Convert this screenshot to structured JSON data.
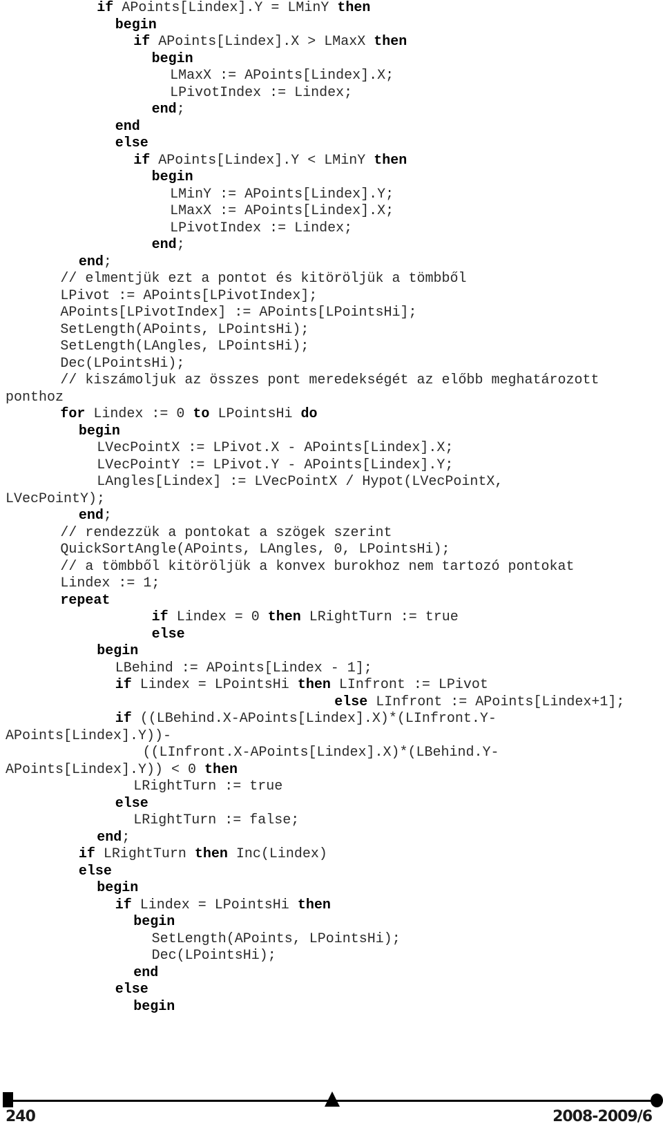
{
  "code_lines": [
    {
      "indent": 5,
      "segments": [
        [
          "k",
          "if"
        ],
        [
          "t",
          " APoints[Lindex].Y = LMinY "
        ],
        [
          "k",
          "then"
        ]
      ]
    },
    {
      "indent": 6,
      "segments": [
        [
          "k",
          "begin"
        ]
      ]
    },
    {
      "indent": 7,
      "segments": [
        [
          "k",
          "if"
        ],
        [
          "t",
          " APoints[Lindex].X > LMaxX "
        ],
        [
          "k",
          "then"
        ]
      ]
    },
    {
      "indent": 8,
      "segments": [
        [
          "k",
          "begin"
        ]
      ]
    },
    {
      "indent": 9,
      "segments": [
        [
          "t",
          "LMaxX := APoints[Lindex].X;"
        ]
      ]
    },
    {
      "indent": 9,
      "segments": [
        [
          "t",
          "LPivotIndex := Lindex;"
        ]
      ]
    },
    {
      "indent": 8,
      "segments": [
        [
          "k",
          "end"
        ],
        [
          "t",
          ";"
        ]
      ]
    },
    {
      "indent": 6,
      "segments": [
        [
          "k",
          "end"
        ]
      ]
    },
    {
      "indent": 6,
      "segments": [
        [
          "k",
          "else"
        ]
      ]
    },
    {
      "indent": 7,
      "segments": [
        [
          "k",
          "if"
        ],
        [
          "t",
          " APoints[Lindex].Y < LMinY "
        ],
        [
          "k",
          "then"
        ]
      ]
    },
    {
      "indent": 8,
      "segments": [
        [
          "k",
          "begin"
        ]
      ]
    },
    {
      "indent": 9,
      "segments": [
        [
          "t",
          "LMinY := APoints[Lindex].Y;"
        ]
      ]
    },
    {
      "indent": 9,
      "segments": [
        [
          "t",
          "LMaxX := APoints[Lindex].X;"
        ]
      ]
    },
    {
      "indent": 9,
      "segments": [
        [
          "t",
          "LPivotIndex := Lindex;"
        ]
      ]
    },
    {
      "indent": 8,
      "segments": [
        [
          "k",
          "end"
        ],
        [
          "t",
          ";"
        ]
      ]
    },
    {
      "indent": 4,
      "segments": [
        [
          "k",
          "end"
        ],
        [
          "t",
          ";"
        ]
      ]
    },
    {
      "indent": 3,
      "segments": [
        [
          "t",
          "// elmentjük ezt a pontot és kitöröljük a tömbből"
        ]
      ]
    },
    {
      "indent": 3,
      "segments": [
        [
          "t",
          "LPivot := APoints[LPivotIndex];"
        ]
      ]
    },
    {
      "indent": 3,
      "segments": [
        [
          "t",
          "APoints[LPivotIndex] := APoints[LPointsHi];"
        ]
      ]
    },
    {
      "indent": 3,
      "segments": [
        [
          "t",
          "SetLength(APoints, LPointsHi);"
        ]
      ]
    },
    {
      "indent": 3,
      "segments": [
        [
          "t",
          "SetLength(LAngles, LPointsHi);"
        ]
      ]
    },
    {
      "indent": 3,
      "segments": [
        [
          "t",
          "Dec(LPointsHi);"
        ]
      ]
    },
    {
      "indent": 3,
      "segments": [
        [
          "t",
          "// kiszámoljuk az összes pont meredekségét az előbb meghatározott"
        ]
      ]
    },
    {
      "indent": 0,
      "segments": [
        [
          "t",
          "ponthoz"
        ]
      ]
    },
    {
      "indent": 3,
      "segments": [
        [
          "k",
          "for"
        ],
        [
          "t",
          " Lindex := 0 "
        ],
        [
          "k",
          "to"
        ],
        [
          "t",
          " LPointsHi "
        ],
        [
          "k",
          "do"
        ]
      ]
    },
    {
      "indent": 4,
      "segments": [
        [
          "k",
          "begin"
        ]
      ]
    },
    {
      "indent": 5,
      "segments": [
        [
          "t",
          "LVecPointX := LPivot.X - APoints[Lindex].X;"
        ]
      ]
    },
    {
      "indent": 5,
      "segments": [
        [
          "t",
          "LVecPointY := LPivot.Y - APoints[Lindex].Y;"
        ]
      ]
    },
    {
      "indent": 5,
      "segments": [
        [
          "t",
          "LAngles[Lindex] := LVecPointX / Hypot(LVecPointX,"
        ]
      ]
    },
    {
      "indent": 0,
      "segments": [
        [
          "t",
          "LVecPointY);"
        ]
      ]
    },
    {
      "indent": 4,
      "segments": [
        [
          "k",
          "end"
        ],
        [
          "t",
          ";"
        ]
      ]
    },
    {
      "indent": 3,
      "segments": [
        [
          "t",
          "// rendezzük a pontokat a szögek szerint"
        ]
      ]
    },
    {
      "indent": 3,
      "segments": [
        [
          "t",
          "QuickSortAngle(APoints, LAngles, 0, LPointsHi);"
        ]
      ]
    },
    {
      "indent": 3,
      "segments": [
        [
          "t",
          "// a tömbből kitöröljük a konvex burokhoz nem tartozó pontokat"
        ]
      ]
    },
    {
      "indent": 3,
      "segments": [
        [
          "t",
          "Lindex := 1;"
        ]
      ]
    },
    {
      "indent": 3,
      "segments": [
        [
          "k",
          "repeat"
        ]
      ]
    },
    {
      "indent": 8,
      "segments": [
        [
          "k",
          "if"
        ],
        [
          "t",
          " Lindex = 0 "
        ],
        [
          "k",
          "then"
        ],
        [
          "t",
          " LRightTurn := true"
        ]
      ]
    },
    {
      "indent": 8,
      "segments": [
        [
          "k",
          "else"
        ]
      ]
    },
    {
      "indent": 5,
      "segments": [
        [
          "k",
          "begin"
        ]
      ]
    },
    {
      "indent": 6,
      "segments": [
        [
          "t",
          "LBehind := APoints[Lindex - 1];"
        ]
      ]
    },
    {
      "indent": 6,
      "segments": [
        [
          "k",
          "if"
        ],
        [
          "t",
          " Lindex = LPointsHi "
        ],
        [
          "k",
          "then"
        ],
        [
          "t",
          " LInfront := LPivot"
        ]
      ]
    },
    {
      "indent": 18,
      "segments": [
        [
          "k",
          "else"
        ],
        [
          "t",
          " LInfront := APoints[Lindex+1];"
        ]
      ]
    },
    {
      "indent": 6,
      "segments": [
        [
          "k",
          "if"
        ],
        [
          "t",
          " ((LBehind.X-APoints[Lindex].X)*(LInfront.Y-"
        ]
      ]
    },
    {
      "indent": 0,
      "segments": [
        [
          "t",
          "APoints[Lindex].Y))-"
        ]
      ]
    },
    {
      "indent": 7.5,
      "segments": [
        [
          "t",
          "((LInfront.X-APoints[Lindex].X)*(LBehind.Y-"
        ]
      ]
    },
    {
      "indent": 0,
      "segments": [
        [
          "t",
          "APoints[Lindex].Y)) < 0 "
        ],
        [
          "k",
          "then"
        ]
      ]
    },
    {
      "indent": 7,
      "segments": [
        [
          "t",
          "LRightTurn := true"
        ]
      ]
    },
    {
      "indent": 6,
      "segments": [
        [
          "k",
          "else"
        ]
      ]
    },
    {
      "indent": 7,
      "segments": [
        [
          "t",
          "LRightTurn := false;"
        ]
      ]
    },
    {
      "indent": 5,
      "segments": [
        [
          "k",
          "end"
        ],
        [
          "t",
          ";"
        ]
      ]
    },
    {
      "indent": 4,
      "segments": [
        [
          "k",
          "if"
        ],
        [
          "t",
          " LRightTurn "
        ],
        [
          "k",
          "then"
        ],
        [
          "t",
          " Inc(Lindex)"
        ]
      ]
    },
    {
      "indent": 4,
      "segments": [
        [
          "k",
          "else"
        ]
      ]
    },
    {
      "indent": 5,
      "segments": [
        [
          "k",
          "begin"
        ]
      ]
    },
    {
      "indent": 6,
      "segments": [
        [
          "k",
          "if"
        ],
        [
          "t",
          " Lindex = LPointsHi "
        ],
        [
          "k",
          "then"
        ]
      ]
    },
    {
      "indent": 7,
      "segments": [
        [
          "k",
          "begin"
        ]
      ]
    },
    {
      "indent": 8,
      "segments": [
        [
          "t",
          "SetLength(APoints, LPointsHi);"
        ]
      ]
    },
    {
      "indent": 8,
      "segments": [
        [
          "t",
          "Dec(LPointsHi);"
        ]
      ]
    },
    {
      "indent": 7,
      "segments": [
        [
          "k",
          "end"
        ]
      ]
    },
    {
      "indent": 6,
      "segments": [
        [
          "k",
          "else"
        ]
      ]
    },
    {
      "indent": 7,
      "segments": [
        [
          "k",
          "begin"
        ]
      ]
    }
  ],
  "footer": {
    "page_number": "240",
    "issue": "2008-2009/6"
  }
}
